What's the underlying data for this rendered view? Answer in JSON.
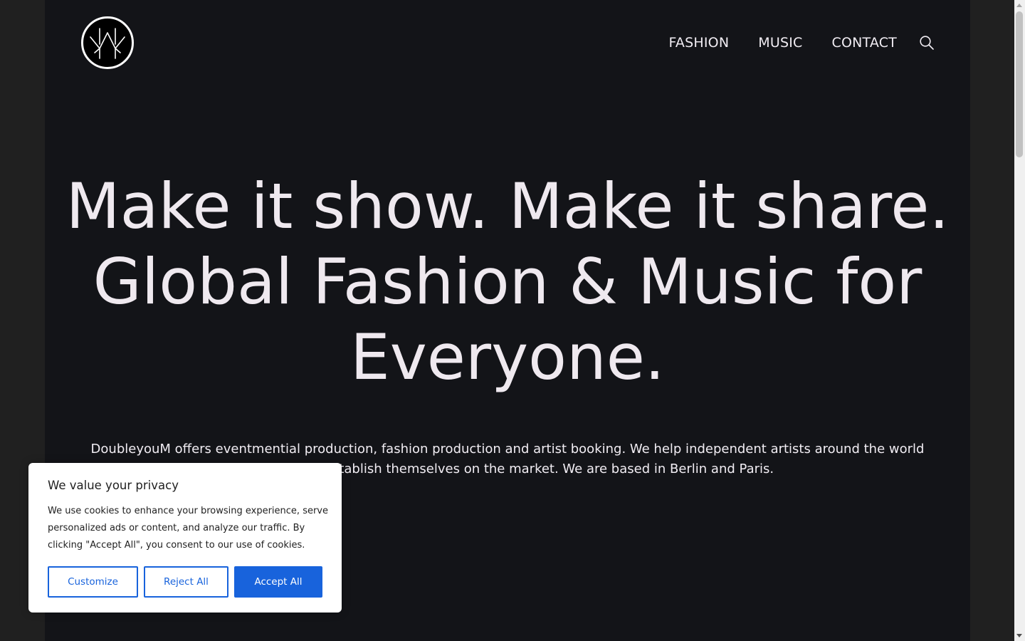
{
  "header": {
    "logo_icon": "dm-monogram-logo",
    "nav": [
      {
        "label": "FASHION"
      },
      {
        "label": "MUSIC"
      },
      {
        "label": "CONTACT"
      }
    ],
    "search_icon": "search-icon"
  },
  "hero": {
    "title": "Make it show. Make it share. Global Fashion & Music for Everyone.",
    "text": "DoubleyouM offers eventmential production, fashion production and artist booking. We help independent artists around the world develop and establish themselves on the market. We are based in Berlin and Paris."
  },
  "cookie_banner": {
    "title": "We value your privacy",
    "text": "We use cookies to enhance your browsing experience, serve personalized ads or content, and analyze our traffic. By clicking \"Accept All\", you consent to our use of cookies.",
    "customize_label": "Customize",
    "reject_label": "Reject All",
    "accept_label": "Accept All"
  },
  "colors": {
    "page_bg": "#131418",
    "outer_bg": "#202020",
    "text": "#f1edf3",
    "accent": "#1863dc"
  }
}
